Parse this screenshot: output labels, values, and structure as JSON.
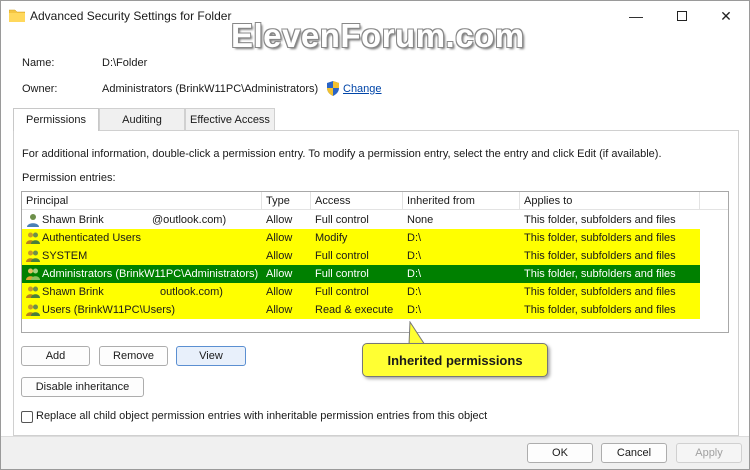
{
  "window": {
    "title": "Advanced Security Settings for Folder",
    "watermark": "ElevenForum.com"
  },
  "info": {
    "name_label": "Name:",
    "name_value": "D:\\Folder",
    "owner_label": "Owner:",
    "owner_value": "Administrators (BrinkW11PC\\Administrators)",
    "change_label": "Change"
  },
  "tabs": [
    {
      "label": "Permissions",
      "active": true
    },
    {
      "label": "Auditing",
      "active": false
    },
    {
      "label": "Effective Access",
      "active": false
    }
  ],
  "panel": {
    "instructions": "For additional information, double-click a permission entry. To modify a permission entry, select the entry and click Edit (if available).",
    "entries_label": "Permission entries:"
  },
  "table": {
    "columns": [
      "Principal",
      "Type",
      "Access",
      "Inherited from",
      "Applies to"
    ],
    "rows": [
      {
        "principal": "Shawn Brink",
        "principal_suffix": "@outlook.com)",
        "type": "Allow",
        "access": "Full control",
        "inherited": "None",
        "applies": "This folder, subfolders and files",
        "highlight": "none"
      },
      {
        "principal": "Authenticated Users",
        "type": "Allow",
        "access": "Modify",
        "inherited": "D:\\",
        "applies": "This folder, subfolders and files",
        "highlight": "yellow"
      },
      {
        "principal": "SYSTEM",
        "type": "Allow",
        "access": "Full control",
        "inherited": "D:\\",
        "applies": "This folder, subfolders and files",
        "highlight": "yellow"
      },
      {
        "principal": "Administrators (BrinkW11PC\\Administrators)",
        "type": "Allow",
        "access": "Full control",
        "inherited": "D:\\",
        "applies": "This folder, subfolders and files",
        "highlight": "green"
      },
      {
        "principal": "Shawn Brink",
        "principal_suffix": "outlook.com)",
        "type": "Allow",
        "access": "Full control",
        "inherited": "D:\\",
        "applies": "This folder, subfolders and files",
        "highlight": "yellow"
      },
      {
        "principal": "Users (BrinkW11PC\\Users)",
        "type": "Allow",
        "access": "Read & execute",
        "inherited": "D:\\",
        "applies": "This folder, subfolders and files",
        "highlight": "yellow"
      }
    ]
  },
  "buttons": {
    "add": "Add",
    "remove": "Remove",
    "view": "View",
    "disable_inheritance": "Disable inheritance",
    "ok": "OK",
    "cancel": "Cancel",
    "apply": "Apply"
  },
  "callout": {
    "text": "Inherited permissions"
  },
  "replace_checkbox": {
    "label": "Replace all child object permission entries with inheritable permission entries from this object",
    "checked": false
  },
  "colors": {
    "highlight_yellow": "#ffff00",
    "highlight_green": "#008000",
    "link": "#0045a8",
    "accent": "#5b8fd1"
  }
}
